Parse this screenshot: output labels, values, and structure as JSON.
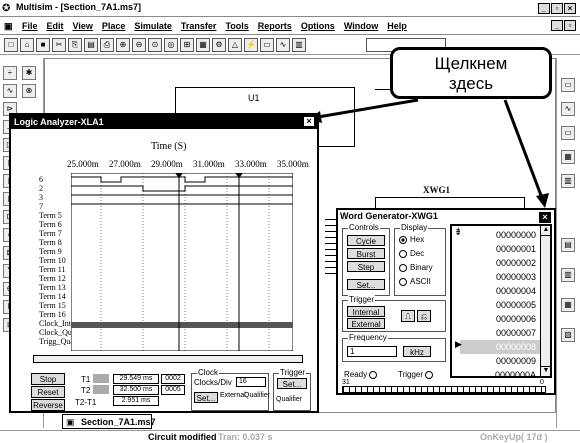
{
  "app": {
    "title": "Multisim - [Section_7A1.ms7]"
  },
  "menu": [
    "File",
    "Edit",
    "View",
    "Place",
    "Simulate",
    "Transfer",
    "Tools",
    "Reports",
    "Options",
    "Window",
    "Help"
  ],
  "canvas": {
    "part_label": "U1",
    "xwg_label": "XWG1"
  },
  "callout": {
    "line1": "Щелкнем",
    "line2": "здесь"
  },
  "logic_analyzer": {
    "title": "Logic Analyzer-XLA1",
    "time_title": "Time (S)",
    "time_ticks": [
      "25.000m",
      "27.000m",
      "29.000m",
      "31.000m",
      "33.000m",
      "35.000m"
    ],
    "channels": [
      "6",
      "2",
      "3",
      "7",
      "Term 5",
      "Term 6",
      "Term 7",
      "Term 8",
      "Term 9",
      "Term 10",
      "Term 11",
      "Term 12",
      "Term 13",
      "Term 14",
      "Term 15",
      "Term 16",
      "Clock_Int",
      "Clock_Qua",
      "Trigg_Qua"
    ],
    "stop": "Stop",
    "reset": "Reset",
    "reverse": "Reverse",
    "t1": "T1",
    "t2": "T2",
    "t2t1": "T2-T1",
    "t1_val": "29.549 ms",
    "t2_val": "32.500 ms",
    "t2t1_val": "2.951 ms",
    "t1_hex": "0002",
    "t2_hex": "0005",
    "clock_label": "Clock",
    "clocks_div_label": "Clocks/Div",
    "clocks_div": "16",
    "set": "Set...",
    "external": "External",
    "qualifier": "Qualifier",
    "trigger_label": "Trigger",
    "trig_set": "Set...",
    "trig_qualifier": "Qualifier"
  },
  "word_generator": {
    "title": "Word Generator-XWG1",
    "controls_label": "Controls",
    "cycle": "Cycle",
    "burst": "Burst",
    "step": "Step",
    "set": "Set...",
    "display_label": "Display",
    "hex": "Hex",
    "dec": "Dec",
    "binary": "Binary",
    "ascii": "ASCII",
    "trigger_label": "Trigger",
    "internal": "Internal",
    "external": "External",
    "frequency_label": "Frequency",
    "frequency_value": "1",
    "frequency_unit": "kHz",
    "ready": "Ready",
    "trigger": "Trigger",
    "bits_left": "31",
    "bits_right": "0",
    "addresses": [
      "00000000",
      "00000001",
      "00000002",
      "00000003",
      "00000004",
      "00000005",
      "00000006",
      "00000007",
      "00000008",
      "00000009",
      "0000000A"
    ]
  },
  "tab": {
    "label": "Section_7A1.ms7"
  },
  "status": {
    "circuit": "Circuit modified",
    "tran": "Tran: 0.037 s",
    "onkey": "OnKeyUp( 17d )"
  }
}
